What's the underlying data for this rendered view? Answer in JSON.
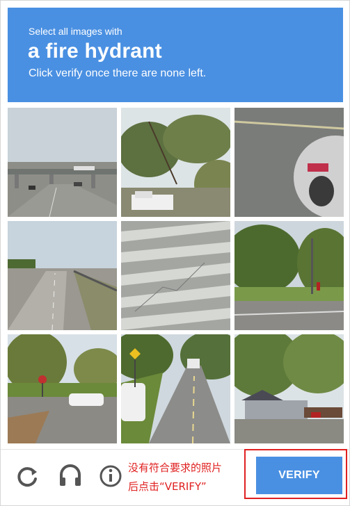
{
  "header": {
    "instruction_line": "Select all images with",
    "target_object": "a fire hydrant",
    "hint": "Click verify once there are none left."
  },
  "grid": {
    "tiles": [
      {
        "scene": "highway overpass"
      },
      {
        "scene": "trees and white truck"
      },
      {
        "scene": "parked white car"
      },
      {
        "scene": "road with barrier"
      },
      {
        "scene": "crosswalk overhead"
      },
      {
        "scene": "street corner with trees"
      },
      {
        "scene": "road with white car and stop sign"
      },
      {
        "scene": "residential street with parked cars"
      },
      {
        "scene": "house with trees"
      }
    ]
  },
  "footer": {
    "icons": [
      "reload-icon",
      "headphones-icon",
      "info-icon"
    ],
    "note_line1": "没有符合要求的照片",
    "note_line2": "后点击“VERIFY”",
    "verify_label": "VERIFY"
  },
  "colors": {
    "accent": "#4a90e2",
    "annotation": "#e02020"
  }
}
